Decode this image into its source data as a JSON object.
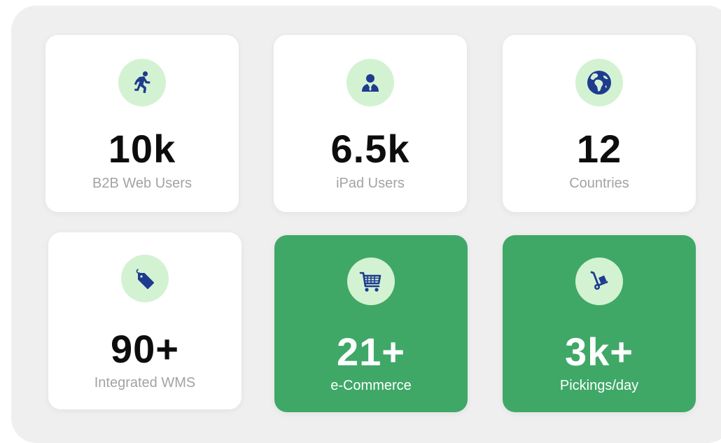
{
  "colors": {
    "panel_bg": "#efefef",
    "card_bg": "#ffffff",
    "accent_green": "#3fa867",
    "icon_circle_bg": "#d3f2d2",
    "icon_blue": "#1f3b8f",
    "label_gray": "#a3a3a3"
  },
  "stats": [
    {
      "value": "10k",
      "label": "B2B Web Users",
      "icon": "running-person-icon",
      "highlighted": false
    },
    {
      "value": "6.5k",
      "label": "iPad Users",
      "icon": "businessman-icon",
      "highlighted": false
    },
    {
      "value": "12",
      "label": "Countries",
      "icon": "globe-icon",
      "highlighted": false
    },
    {
      "value": "90+",
      "label": "Integrated WMS",
      "icon": "price-tag-icon",
      "highlighted": false
    },
    {
      "value": "21+",
      "label": "e-Commerce",
      "icon": "shopping-cart-icon",
      "highlighted": true
    },
    {
      "value": "3k+",
      "label": "Pickings/day",
      "icon": "hand-truck-icon",
      "highlighted": true
    }
  ]
}
